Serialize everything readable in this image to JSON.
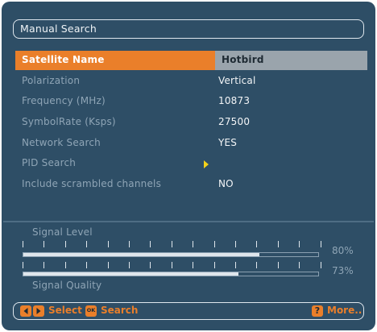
{
  "title": "Manual Search",
  "rows": [
    {
      "label": "Satellite Name",
      "value": "Hotbird",
      "selected": true
    },
    {
      "label": "Polarization",
      "value": "Vertical"
    },
    {
      "label": "Frequency (MHz)",
      "value": "10873"
    },
    {
      "label": "SymbolRate (Ksps)",
      "value": "27500"
    },
    {
      "label": "Network Search",
      "value": "YES"
    },
    {
      "label": "PID Search",
      "value": ""
    },
    {
      "label": "Include scrambled channels",
      "value": "NO"
    }
  ],
  "signal": {
    "level_label": "Signal Level",
    "level_pct": "80%",
    "level_value": 0.8,
    "quality_label": "Signal Quality",
    "quality_pct": "73%",
    "quality_value": 0.73
  },
  "footer": {
    "select_label": "Select",
    "search_label": "Search",
    "ok_label": "OK",
    "help_label": "?",
    "more_label": "More.."
  },
  "colors": {
    "accent": "#ea7f2a",
    "background": "#2e4e66",
    "arrow": "#f4d21a"
  }
}
